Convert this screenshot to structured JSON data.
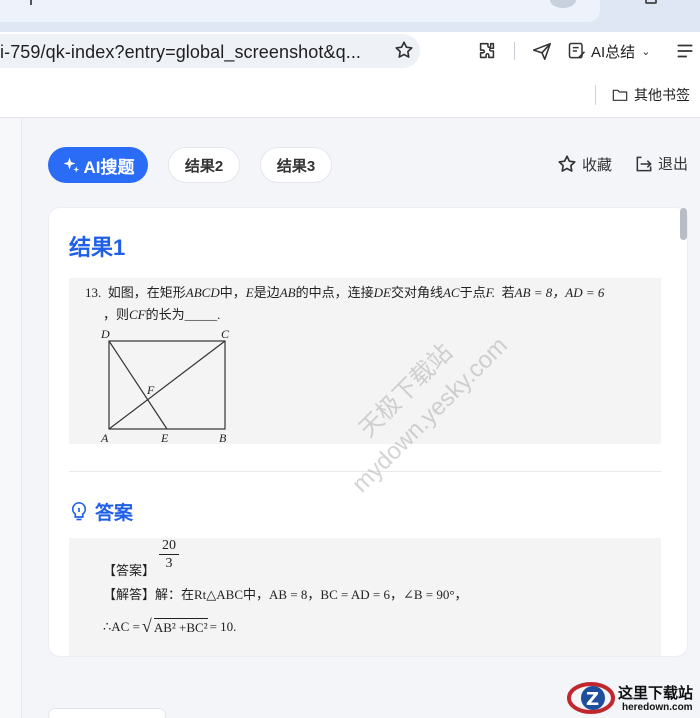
{
  "browser": {
    "url": "i-759/qk-index?entry=global_screenshot&q...",
    "ai_summary_label": "AI总结",
    "bookmark_folder": "其他书签"
  },
  "topbar": {
    "ai_search_label": "AI搜题",
    "tabs": [
      "结果2",
      "结果3"
    ],
    "collect_label": "收藏",
    "exit_label": "退出"
  },
  "result": {
    "title": "结果1",
    "question": {
      "number": "13.",
      "line1_pre": "如图，在矩形",
      "rect_name": "ABCD",
      "line1_mid1": "中，",
      "point_e": "E",
      "line1_mid2": "是边",
      "side_ab": "AB",
      "line1_mid3": "的中点，连接",
      "seg_de": "DE",
      "line1_mid4": "交对角线",
      "diag_ac": "AC",
      "line1_mid5": "于点",
      "point_f": "F.",
      "line1_mid6": "若",
      "cond1": "AB = 8，",
      "cond2": "AD = 6",
      "line2_pre": "，则",
      "seg_cf": "CF",
      "line2_post": "的长为_____.",
      "figure_labels": [
        "D",
        "C",
        "F",
        "A",
        "E",
        "B"
      ]
    },
    "answer_heading": "答案",
    "answer": {
      "label": "【答案】",
      "frac_num": "20",
      "frac_den": "3",
      "solution_line": "【解答】解：在Rt△ABC中，AB = 8，BC = AD = 6，∠B = 90°，",
      "ac_prefix": "∴AC =",
      "ac_sqrt": "AB² +BC²",
      "ac_suffix": "= 10."
    }
  },
  "watermark": {
    "line1": "天极下载站",
    "line2": "mydown.yesky.com"
  },
  "corner_logo": {
    "title": "这里下载站",
    "domain": "heredown.com"
  },
  "colors": {
    "accent": "#2b6cf6",
    "title_blue": "#2060e8",
    "page_bg": "#f3f5f9"
  }
}
